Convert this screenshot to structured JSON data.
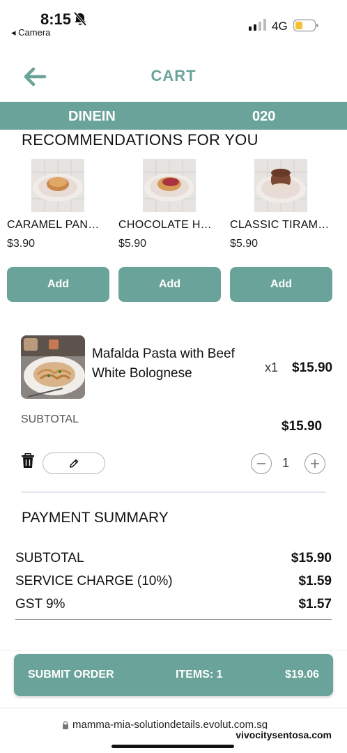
{
  "status": {
    "time": "8:15",
    "back_app": "◂ Camera",
    "network": "4G"
  },
  "header": {
    "title": "CART"
  },
  "band": {
    "mode": "DINEIN",
    "table": "020"
  },
  "recommendations": {
    "title": "RECOMMENDATIONS FOR YOU",
    "items": [
      {
        "name": "CARAMEL PAN…",
        "price": "$3.90",
        "add_label": "Add"
      },
      {
        "name": "CHOCOLATE H…",
        "price": "$5.90",
        "add_label": "Add"
      },
      {
        "name": "CLASSIC TIRAM…",
        "price": "$5.90",
        "add_label": "Add"
      }
    ]
  },
  "cart_item": {
    "name": "Mafalda Pasta with Beef White Bolognese",
    "qty_label": "x1",
    "price": "$15.90",
    "subtotal_label": "SUBTOTAL",
    "subtotal_value": "$15.90",
    "stepper_value": "1"
  },
  "payment": {
    "title": "PAYMENT SUMMARY",
    "rows": [
      {
        "label": "SUBTOTAL",
        "value": "$15.90"
      },
      {
        "label": "SERVICE CHARGE (10%)",
        "value": "$1.59"
      },
      {
        "label": "GST 9%",
        "value": "$1.57"
      }
    ]
  },
  "submit": {
    "label": "SUBMIT ORDER",
    "items": "ITEMS: 1",
    "total": "$19.06"
  },
  "browser": {
    "url": "mamma-mia-solutiondetails.evolut.com.sg",
    "watermark": "vivocitysentosa.com"
  },
  "colors": {
    "accent": "#6aa39a"
  }
}
